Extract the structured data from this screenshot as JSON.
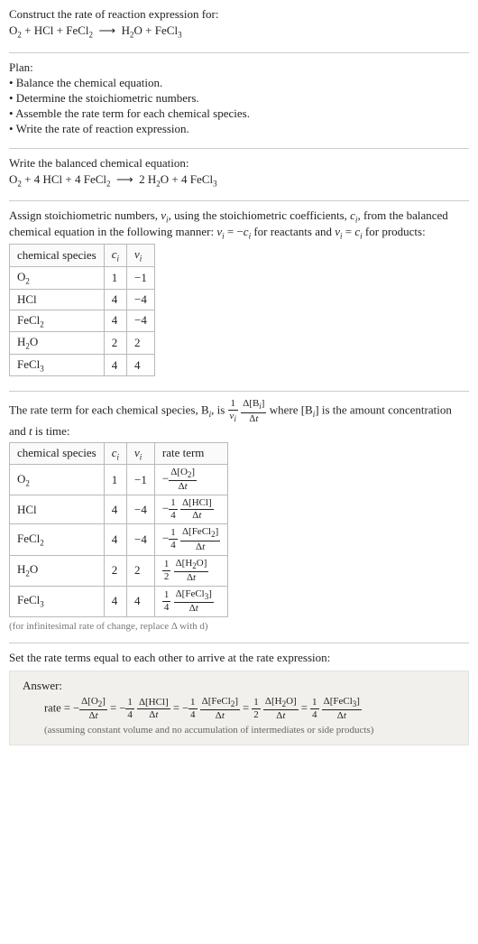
{
  "intro": {
    "title": "Construct the rate of reaction expression for:",
    "equation_html": "O<span class='sub'>2</span> + HCl + FeCl<span class='sub'>2</span> &nbsp;⟶&nbsp; H<span class='sub'>2</span>O + FeCl<span class='sub'>3</span>"
  },
  "plan": {
    "heading": "Plan:",
    "items": [
      "• Balance the chemical equation.",
      "• Determine the stoichiometric numbers.",
      "• Assemble the rate term for each chemical species.",
      "• Write the rate of reaction expression."
    ]
  },
  "balanced": {
    "heading": "Write the balanced chemical equation:",
    "equation_html": "O<span class='sub'>2</span> + 4 HCl + 4 FeCl<span class='sub'>2</span> &nbsp;⟶&nbsp; 2 H<span class='sub'>2</span>O + 4 FeCl<span class='sub'>3</span>"
  },
  "assign": {
    "text_html": "Assign stoichiometric numbers, <i>ν<span class='sub'>i</span></i>, using the stoichiometric coefficients, <i>c<span class='sub'>i</span></i>, from the balanced chemical equation in the following manner: <i>ν<span class='sub'>i</span></i> = −<i>c<span class='sub'>i</span></i> for reactants and <i>ν<span class='sub'>i</span></i> = <i>c<span class='sub'>i</span></i> for products:",
    "headers": {
      "species": "chemical species",
      "ci_html": "<i>c<span class='sub'>i</span></i>",
      "vi_html": "<i>ν<span class='sub'>i</span></i>"
    },
    "rows": [
      {
        "species_html": "O<span class='sub'>2</span>",
        "ci": "1",
        "vi": "−1"
      },
      {
        "species_html": "HCl",
        "ci": "4",
        "vi": "−4"
      },
      {
        "species_html": "FeCl<span class='sub'>2</span>",
        "ci": "4",
        "vi": "−4"
      },
      {
        "species_html": "H<span class='sub'>2</span>O",
        "ci": "2",
        "vi": "2"
      },
      {
        "species_html": "FeCl<span class='sub'>3</span>",
        "ci": "4",
        "vi": "4"
      }
    ]
  },
  "rateterm": {
    "text_before": "The rate term for each chemical species, B",
    "text_mid1": ", is ",
    "text_after1": " where [B",
    "text_after2": "] is the amount concentration and ",
    "text_after3": " is time:",
    "headers": {
      "species": "chemical species",
      "ci_html": "<i>c<span class='sub'>i</span></i>",
      "vi_html": "<i>ν<span class='sub'>i</span></i>",
      "rate": "rate term"
    },
    "rows": [
      {
        "species_html": "O<span class='sub'>2</span>",
        "ci": "1",
        "vi": "−1",
        "rate_html": "−<span class='frac'><span class='num'>Δ[O<span class='sub'>2</span>]</span><span class='den'>Δ<i>t</i></span></span>"
      },
      {
        "species_html": "HCl",
        "ci": "4",
        "vi": "−4",
        "rate_html": "−<span class='frac'><span class='num'>1</span><span class='den'>4</span></span> <span class='frac'><span class='num'>Δ[HCl]</span><span class='den'>Δ<i>t</i></span></span>"
      },
      {
        "species_html": "FeCl<span class='sub'>2</span>",
        "ci": "4",
        "vi": "−4",
        "rate_html": "−<span class='frac'><span class='num'>1</span><span class='den'>4</span></span> <span class='frac'><span class='num'>Δ[FeCl<span class='sub'>2</span>]</span><span class='den'>Δ<i>t</i></span></span>"
      },
      {
        "species_html": "H<span class='sub'>2</span>O",
        "ci": "2",
        "vi": "2",
        "rate_html": "<span class='frac'><span class='num'>1</span><span class='den'>2</span></span> <span class='frac'><span class='num'>Δ[H<span class='sub'>2</span>O]</span><span class='den'>Δ<i>t</i></span></span>"
      },
      {
        "species_html": "FeCl<span class='sub'>3</span>",
        "ci": "4",
        "vi": "4",
        "rate_html": "<span class='frac'><span class='num'>1</span><span class='den'>4</span></span> <span class='frac'><span class='num'>Δ[FeCl<span class='sub'>3</span>]</span><span class='den'>Δ<i>t</i></span></span>"
      }
    ],
    "footnote": "(for infinitesimal rate of change, replace Δ with d)"
  },
  "final": {
    "heading": "Set the rate terms equal to each other to arrive at the rate expression:",
    "answer_label": "Answer:",
    "rate_html": "rate = −<span class='frac'><span class='num'>Δ[O<span class='sub'>2</span>]</span><span class='den'>Δ<i>t</i></span></span> = −<span class='frac'><span class='num'>1</span><span class='den'>4</span></span> <span class='frac'><span class='num'>Δ[HCl]</span><span class='den'>Δ<i>t</i></span></span> = −<span class='frac'><span class='num'>1</span><span class='den'>4</span></span> <span class='frac'><span class='num'>Δ[FeCl<span class='sub'>2</span>]</span><span class='den'>Δ<i>t</i></span></span> = <span class='frac'><span class='num'>1</span><span class='den'>2</span></span> <span class='frac'><span class='num'>Δ[H<span class='sub'>2</span>O]</span><span class='den'>Δ<i>t</i></span></span> = <span class='frac'><span class='num'>1</span><span class='den'>4</span></span> <span class='frac'><span class='num'>Δ[FeCl<span class='sub'>3</span>]</span><span class='den'>Δ<i>t</i></span></span>",
    "note": "(assuming constant volume and no accumulation of intermediates or side products)"
  },
  "chart_data": {
    "type": "table",
    "tables": [
      {
        "title": "Stoichiometric numbers",
        "columns": [
          "chemical species",
          "c_i",
          "ν_i"
        ],
        "rows": [
          [
            "O2",
            1,
            -1
          ],
          [
            "HCl",
            4,
            -4
          ],
          [
            "FeCl2",
            4,
            -4
          ],
          [
            "H2O",
            2,
            2
          ],
          [
            "FeCl3",
            4,
            4
          ]
        ]
      },
      {
        "title": "Rate terms",
        "columns": [
          "chemical species",
          "c_i",
          "ν_i",
          "rate term"
        ],
        "rows": [
          [
            "O2",
            1,
            -1,
            "-Δ[O2]/Δt"
          ],
          [
            "HCl",
            4,
            -4,
            "-(1/4) Δ[HCl]/Δt"
          ],
          [
            "FeCl2",
            4,
            -4,
            "-(1/4) Δ[FeCl2]/Δt"
          ],
          [
            "H2O",
            2,
            2,
            "(1/2) Δ[H2O]/Δt"
          ],
          [
            "FeCl3",
            4,
            4,
            "(1/4) Δ[FeCl3]/Δt"
          ]
        ]
      }
    ]
  }
}
